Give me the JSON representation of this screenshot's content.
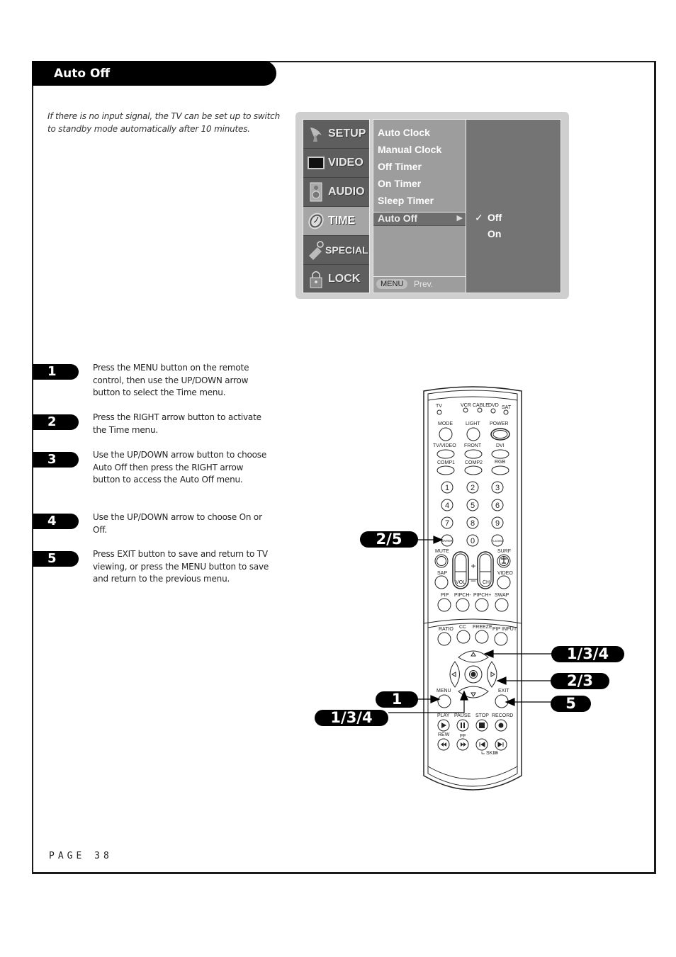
{
  "header": {
    "title": "Auto Off"
  },
  "intro": "If there is no input signal, the TV can be set up to switch to standby mode automatically after 10 minutes.",
  "osd": {
    "categories": [
      {
        "label": "SETUP",
        "icon": "satellite-dish-icon",
        "selected": false
      },
      {
        "label": "VIDEO",
        "icon": "screen-icon",
        "selected": false
      },
      {
        "label": "AUDIO",
        "icon": "speaker-icon",
        "selected": false
      },
      {
        "label": "TIME",
        "icon": "clock-icon",
        "selected": true
      },
      {
        "label": "SPECIAL",
        "icon": "tag-icon",
        "selected": false
      },
      {
        "label": "LOCK",
        "icon": "padlock-icon",
        "selected": false
      }
    ],
    "items": [
      "Auto Clock",
      "Manual Clock",
      "Off Timer",
      "On Timer",
      "Sleep Timer",
      "Auto Off"
    ],
    "selected_item": "Auto Off",
    "submenu_arrow": "▶",
    "options": [
      {
        "label": "Off",
        "checked": true
      },
      {
        "label": "On",
        "checked": false
      }
    ],
    "check_mark": "✓",
    "footer": {
      "menu_button": "MENU",
      "prev_label": "Prev."
    }
  },
  "steps": [
    {
      "number": "1",
      "text": "Press the MENU button on the remote control, then use the UP/DOWN arrow button to select the Time menu."
    },
    {
      "number": "2",
      "text": "Press the RIGHT arrow button to activate the Time menu."
    },
    {
      "number": "3",
      "text": "Use the UP/DOWN arrow button to choose Auto Off then press the RIGHT arrow button to access the Auto Off menu."
    },
    {
      "number": "4",
      "text": "Use the UP/DOWN arrow to choose On or Off."
    },
    {
      "number": "5",
      "text": "Press EXIT button to save and return to TV viewing, or press the MENU button to save and return to the previous menu."
    }
  ],
  "callouts": {
    "enter": "2/5",
    "up": "1/3/4",
    "right": "2/3",
    "exit": "5",
    "menu": "1",
    "down": "1/3/4"
  },
  "remote": {
    "modes": [
      "TV",
      "VCR",
      "CABLE",
      "DVD",
      "SAT"
    ],
    "row1": [
      "MODE",
      "LIGHT",
      "POWER"
    ],
    "row2": [
      "TV/VIDEO",
      "FRONT",
      "DVI"
    ],
    "row3": [
      "COMP1",
      "COMP2",
      "RGB"
    ],
    "digits": [
      "1",
      "2",
      "3",
      "4",
      "5",
      "6",
      "7",
      "8",
      "9"
    ],
    "enter": "ENTER",
    "zero": "0",
    "flashbk": "FLASHBK",
    "mute": "MUTE",
    "surf": "SURF",
    "sap": "SAP",
    "video": "VIDEO",
    "vol": "VOL",
    "ch": "CH",
    "plus": "+",
    "minus": "–",
    "pip_row": [
      "PIP",
      "PIPCH-",
      "PIPCH+",
      "SWAP"
    ],
    "lower_row": [
      "RATIO",
      "CC",
      "FREEZE",
      "PIP INPUT"
    ],
    "menu": "MENU",
    "exit": "EXIT",
    "transport1": [
      "PLAY",
      "PAUSE",
      "STOP",
      "RECORD"
    ],
    "transport2": [
      "REW",
      "FF"
    ],
    "skip": "SKIP"
  },
  "footer": {
    "page": "PAGE 38"
  }
}
